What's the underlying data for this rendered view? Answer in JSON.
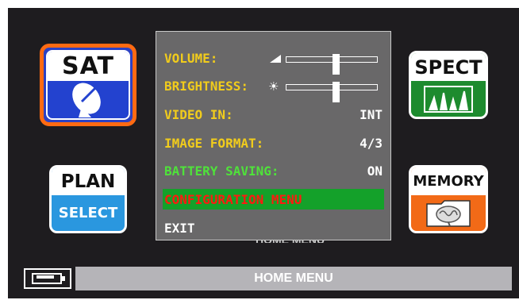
{
  "tiles": {
    "sat": {
      "label": "SAT",
      "icon": "satellite-dish-icon"
    },
    "spect": {
      "label": "SPECT",
      "icon": "spectrum-icon"
    },
    "plan": {
      "top_label": "PLAN",
      "bottom_label": "SELECT"
    },
    "memory": {
      "label": "MEMORY",
      "icon": "brain-folder-icon"
    }
  },
  "menu": {
    "volume": {
      "label": "VOLUME:",
      "level": 0.55
    },
    "brightness": {
      "label": "BRIGHTNESS:",
      "level": 0.55
    },
    "video_in": {
      "label": "VIDEO IN:",
      "value": "INT"
    },
    "image_format": {
      "label": "IMAGE FORMAT:",
      "value": "4/3"
    },
    "battery_saving": {
      "label": "BATTERY SAVING:",
      "value": "ON"
    },
    "configuration_menu": {
      "label": "CONFIGURATION MENU"
    },
    "exit": {
      "label": "EXIT"
    }
  },
  "partial_hidden_text": "HOME MENU",
  "status_bar": {
    "title": "HOME MENU",
    "battery_icon": "battery-charging-icon"
  },
  "colors": {
    "sat_border": "#ff6a12",
    "sat_fill": "#2b41c4",
    "spect_fill": "#1d8b2e",
    "plan_fill": "#2a97df",
    "memory_fill": "#f26a17",
    "menu_yellow": "#f1cc1c",
    "menu_green": "#4fe23a",
    "highlight_green": "#14a12a",
    "highlight_text_red": "#ff1a10"
  }
}
